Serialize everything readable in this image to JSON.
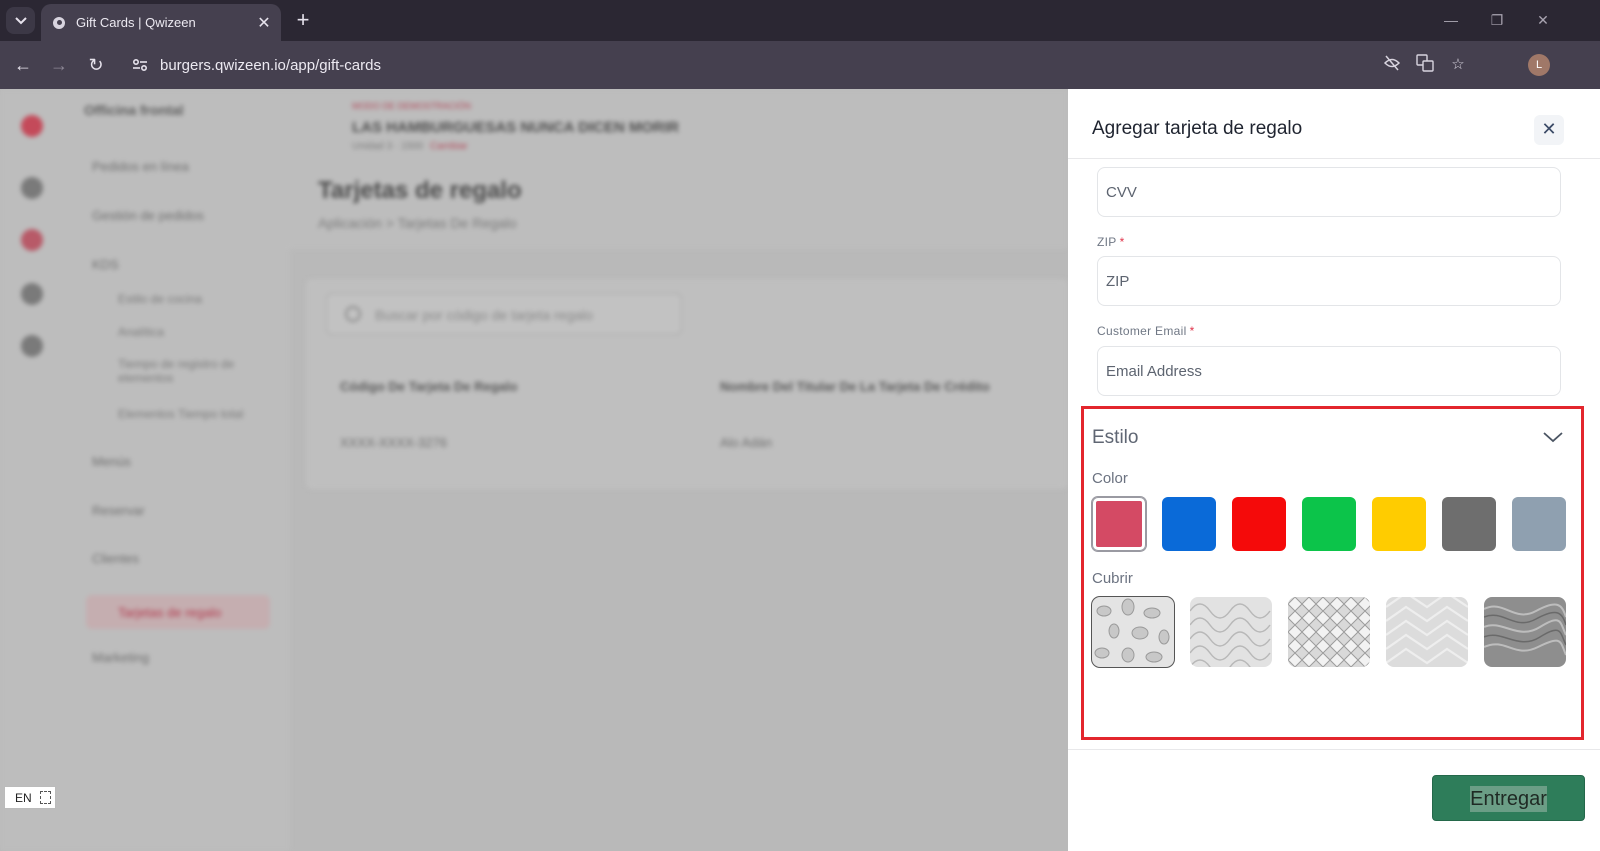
{
  "browser": {
    "tab_title": "Gift Cards | Qwizeen",
    "tab_close": "✕",
    "new_tab": "+",
    "url": "burgers.qwizeen.io/app/gift-cards",
    "profile_initial": "L"
  },
  "app": {
    "sidebar_title": "Officina frontal",
    "nav_items": [
      {
        "label": "Pedidos en línea"
      },
      {
        "label": "Gestión de pedidos"
      },
      {
        "label": "KDS"
      },
      {
        "label": "Menús"
      },
      {
        "label": "Reservar"
      },
      {
        "label": "Clientes"
      },
      {
        "label": "Tarjetas de regalo"
      },
      {
        "label": "Marketing"
      }
    ],
    "nav_sub_items": [
      {
        "label": "Estilo de cocina"
      },
      {
        "label": "Analítica"
      },
      {
        "label": "Tiempo de registro de elementos"
      },
      {
        "label": "Elementos Tiempo total"
      }
    ],
    "store_tag": "MODO DE DEMOSTRACIÓN",
    "store_name": "LAS HAMBURGUESAS NUNCA DICEN MORIR",
    "store_sub": "Unidad 3 · 1500",
    "store_sub_link": "Cambiar",
    "page_title": "Tarjetas de regalo",
    "breadcrumb": "Aplicación  >  Tarjetas De Regalo",
    "search_placeholder": "Buscar por código de tarjeta regalo",
    "table_headers": [
      "Código De Tarjeta De Regalo",
      "Nombre Del Titular De La Tarjeta De Crédito"
    ],
    "table_row": [
      "XXXX-XXXX-3276",
      "Alo Adán"
    ],
    "lang_badge": "EN"
  },
  "drawer": {
    "title": "Agregar tarjeta de regalo",
    "close_icon": "✕",
    "cvv_placeholder": "CVV",
    "zip_label": "ZIP",
    "zip_placeholder": "ZIP",
    "email_label": "Customer Email",
    "email_placeholder": "Email Address",
    "required_mark": "*",
    "style_title": "Estilo",
    "color_label": "Color",
    "colors": [
      "#d44a64",
      "#0a6ad8",
      "#f50a0a",
      "#0cc44a",
      "#ffcc00",
      "#6e6e6e",
      "#8fa0b0"
    ],
    "cover_label": "Cubrir",
    "covers": [
      "leaf-pattern",
      "wave-pattern",
      "lattice-pattern",
      "chevron-pattern",
      "marble-pattern"
    ],
    "submit_label": "Entregar",
    "highlight_color": "#e3262d",
    "submit_color": "#2e7d5a"
  }
}
